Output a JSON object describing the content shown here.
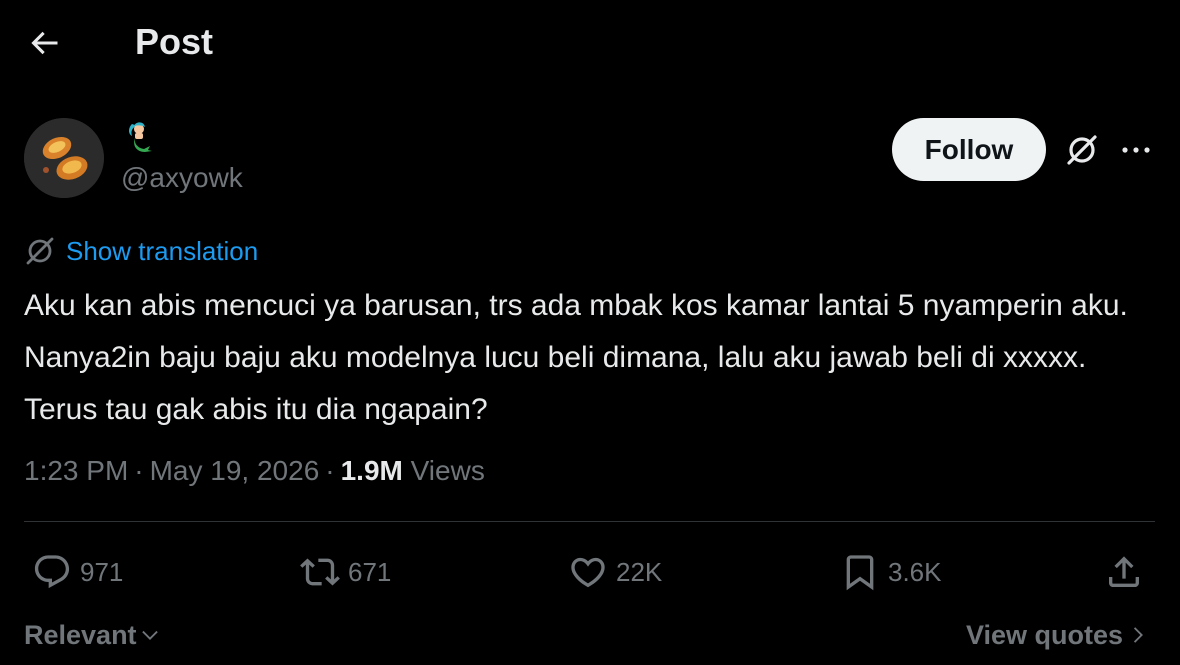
{
  "header": {
    "title": "Post",
    "back_icon": "arrow-left-icon"
  },
  "author": {
    "display_name_emoji": "🧜‍♀️",
    "handle": "@axyowk",
    "follow_label": "Follow"
  },
  "translation": {
    "label": "Show translation"
  },
  "post": {
    "text": "Aku kan abis mencuci ya barusan, trs ada mbak kos kamar lantai 5 nyamperin aku. Nanya2in baju baju aku modelnya lucu beli dimana, lalu aku jawab beli di xxxxx. Terus tau gak abis itu dia ngapain?"
  },
  "meta": {
    "time": "1:23 PM",
    "date": "May 19, 2026",
    "views_count": "1.9M",
    "views_label": "Views",
    "separator": "·"
  },
  "actions": {
    "replies": "971",
    "reposts": "671",
    "likes": "22K",
    "bookmarks": "3.6K"
  },
  "footer": {
    "sort_label": "Relevant",
    "view_quotes_label": "View quotes"
  },
  "colors": {
    "accent": "#1d9bf0",
    "muted": "#71767b",
    "text": "#e7e9ea",
    "background": "#000000"
  }
}
